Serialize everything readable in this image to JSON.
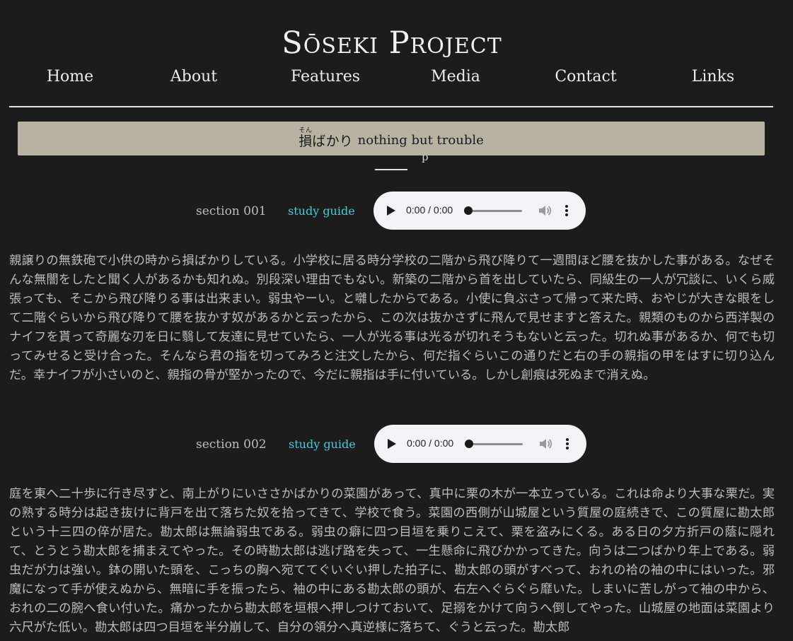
{
  "site": {
    "title": "Sōseki Project"
  },
  "nav": [
    {
      "label": "Home"
    },
    {
      "label": "About"
    },
    {
      "label": "Features"
    },
    {
      "label": "Media"
    },
    {
      "label": "Contact"
    },
    {
      "label": "Links"
    }
  ],
  "banner": {
    "term": "損ばかり",
    "ruby_base": "損",
    "ruby_reading": "そん",
    "rest": "ばかり",
    "gloss": "nothing but trouble"
  },
  "header_partial": "p",
  "sections": [
    {
      "label": "section 001",
      "study_guide": "study guide",
      "audio_time": "0:00 / 0:00",
      "text": "親譲りの無鉄砲で小供の時から損ばかりしている。小学校に居る時分学校の二階から飛び降りて一週間ほど腰を抜かした事がある。なぜそんな無闇をしたと聞く人があるかも知れぬ。別段深い理由でもない。新築の二階から首を出していたら、同級生の一人が冗談に、いくら威張っても、そこから飛び降りる事は出来まい。弱虫やーい。と囃したからである。小使に負ぶさって帰って来た時、おやじが大きな眼をして二階ぐらいから飛び降りて腰を抜かす奴があるかと云ったから、この次は抜かさずに飛んで見せますと答えた。親類のものから西洋製のナイフを貰って奇麗な刃を日に翳して友達に見せていたら、一人が光る事は光るが切れそうもないと云った。切れぬ事があるか、何でも切ってみせると受け合った。そんなら君の指を切ってみろと注文したから、何だ指ぐらいこの通りだと右の手の親指の甲をはすに切り込んだ。幸ナイフが小さいのと、親指の骨が堅かったので、今だに親指は手に付いている。しかし創痕は死ぬまで消えぬ。"
    },
    {
      "label": "section 002",
      "study_guide": "study guide",
      "audio_time": "0:00 / 0:00",
      "text": "庭を東へ二十歩に行き尽すと、南上がりにいささかばかりの菜園があって、真中に栗の木が一本立っている。これは命より大事な栗だ。実の熟する時分は起き抜けに背戸を出て落ちた奴を拾ってきて、学校で食う。菜園の西側が山城屋という質屋の庭続きで、この質屋に勘太郎という十三四の倅が居た。勘太郎は無論弱虫である。弱虫の癖に四つ目垣を乗りこえて、栗を盗みにくる。ある日の夕方折戸の蔭に隠れて、とうとう勘太郎を捕まえてやった。その時勘太郎は逃げ路を失って、一生懸命に飛びかかってきた。向うは二つばかり年上である。弱虫だが力は強い。鉢の開いた頭を、こっちの胸へ宛ててぐいぐい押した拍子に、勘太郎の頭がすべって、おれの袷の袖の中にはいった。邪魔になって手が使えぬから、無暗に手を振ったら、袖の中にある勘太郎の頭が、右左へぐらぐら靡いた。しまいに苦しがって袖の中から、おれの二の腕へ食い付いた。痛かったから勘太郎を垣根へ押しつけておいて、足搦をかけて向うへ倒してやった。山城屋の地面は菜園より六尺がた低い。勘太郎は四つ目垣を半分崩して、自分の領分へ真逆様に落ちて、ぐうと云った。勘太郎"
    }
  ],
  "colors": {
    "background": "#1c1c1c",
    "banner": "#b8b2a3",
    "study_link": "#3fcfd8",
    "text": "#bcbcbc"
  }
}
